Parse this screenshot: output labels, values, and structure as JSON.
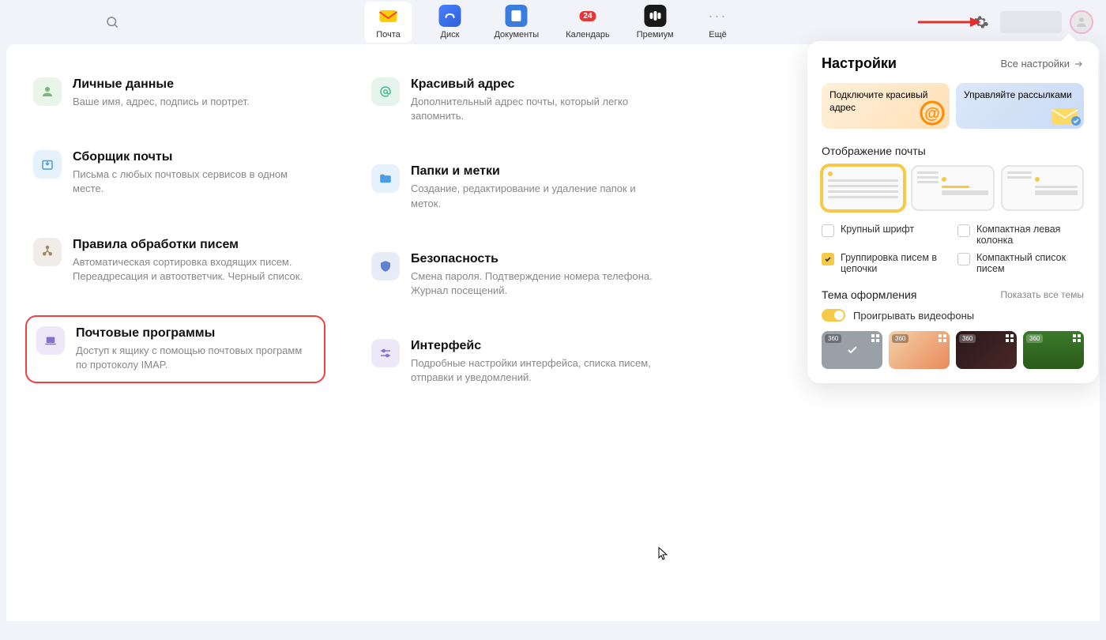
{
  "header": {
    "tabs": [
      {
        "label": "Почта"
      },
      {
        "label": "Диск"
      },
      {
        "label": "Документы"
      },
      {
        "label": "Календарь",
        "badge": "24"
      },
      {
        "label": "Премиум"
      },
      {
        "label": "Ещё"
      }
    ]
  },
  "settings_grid": {
    "col1": [
      {
        "title": "Личные данные",
        "desc": "Ваше имя, адрес, подпись и портрет."
      },
      {
        "title": "Сборщик почты",
        "desc": "Письма с любых почтовых сервисов в одном месте."
      },
      {
        "title": "Правила обработки писем",
        "desc": "Автоматическая сортировка входящих писем. Переадресация и автоответчик. Черный список."
      },
      {
        "title": "Почтовые программы",
        "desc": "Доступ к ящику с помощью почтовых программ по протоколу IMAP."
      }
    ],
    "col2": [
      {
        "title": "Красивый адрес",
        "desc": "Дополнительный адрес почты, который легко запомнить."
      },
      {
        "title": "Папки и метки",
        "desc": "Создание, редактирование и удаление папок и меток."
      },
      {
        "title": "Безопасность",
        "desc": "Смена пароля. Подтверждение номера телефона. Журнал посещений."
      },
      {
        "title": "Интерфейс",
        "desc": "Подробные настройки интерфейса, списка писем, отправки и уведомлений."
      }
    ]
  },
  "panel": {
    "title": "Настройки",
    "all_link": "Все настройки",
    "promo1": "Подключите красивый адрес",
    "promo2": "Управляйте рассылками",
    "display_section": "Отображение почты",
    "checks": {
      "large_font": "Крупный шрифт",
      "compact_left": "Компактная левая колонка",
      "group_threads": "Группировка писем в цепочки",
      "compact_list": "Компактный список писем"
    },
    "theme_section": "Тема оформления",
    "show_all_themes": "Показать все темы",
    "play_video": "Проигрывать видеофоны",
    "badge_360": "360"
  }
}
